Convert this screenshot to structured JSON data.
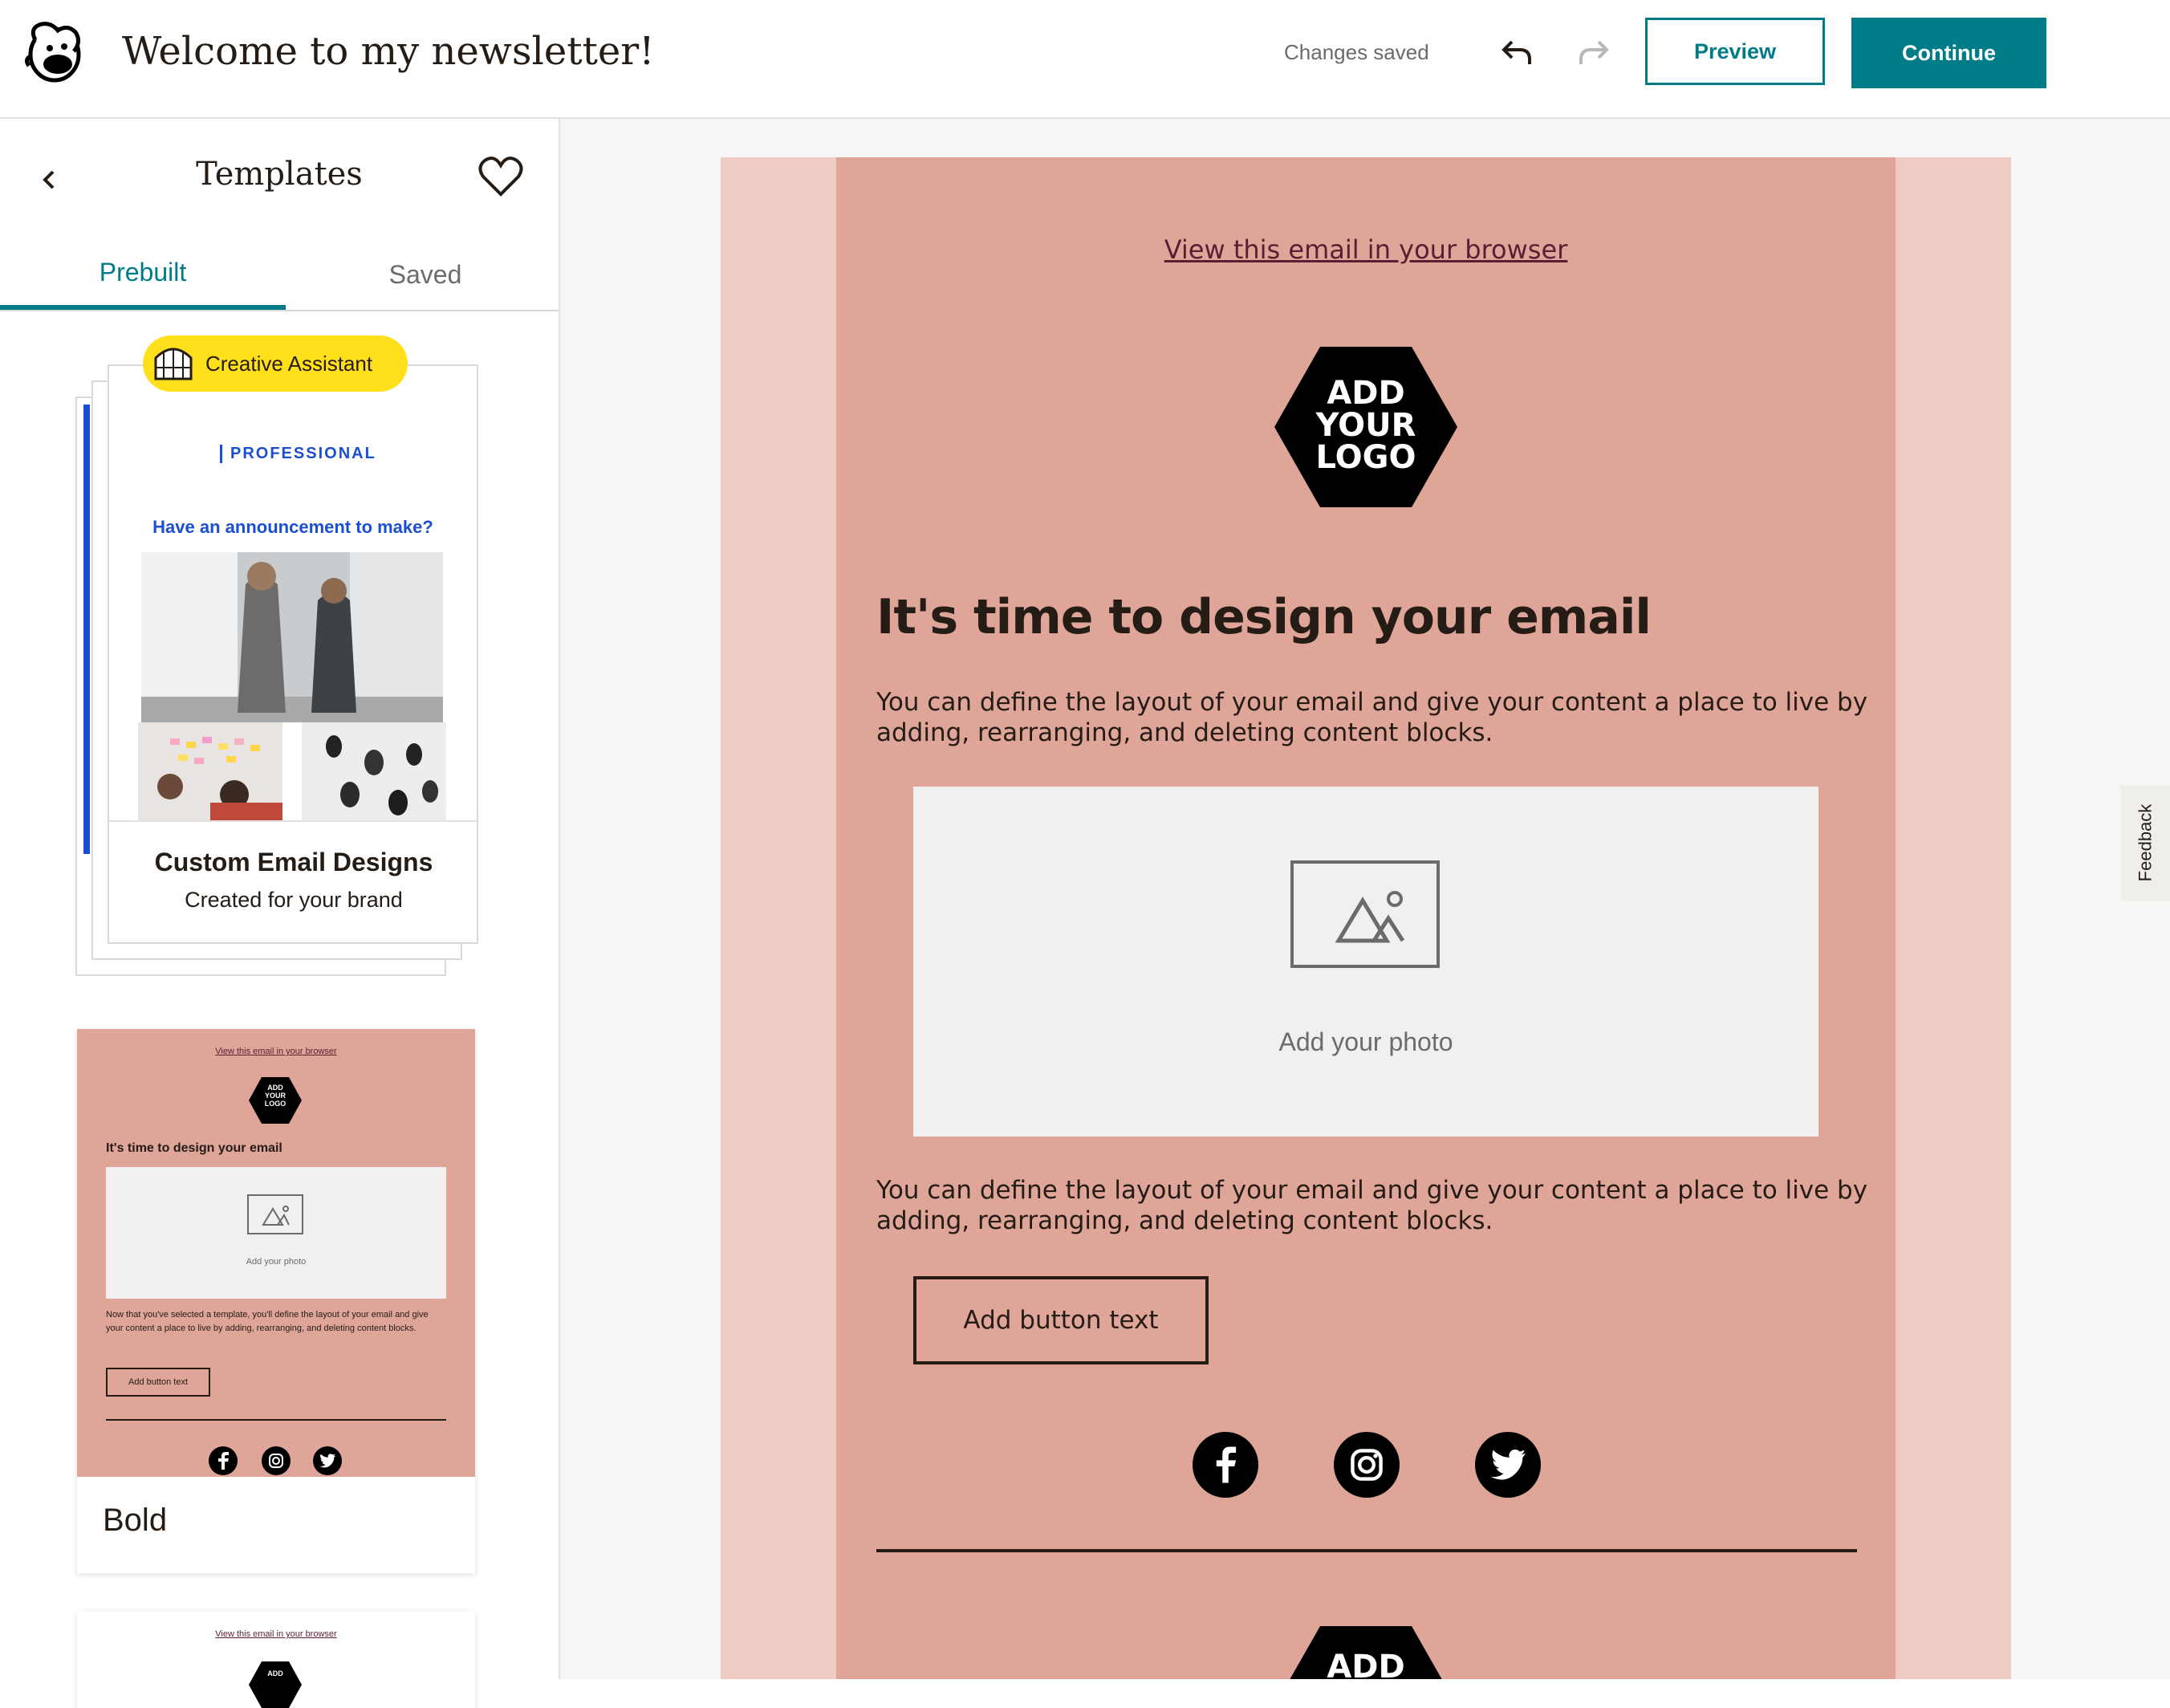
{
  "header": {
    "title": "Welcome to my newsletter!",
    "status": "Changes saved",
    "preview_label": "Preview",
    "continue_label": "Continue"
  },
  "sidebar": {
    "title": "Templates",
    "tabs": [
      {
        "label": "Prebuilt",
        "active": true
      },
      {
        "label": "Saved",
        "active": false
      }
    ],
    "custom_card": {
      "badge": "Creative Assistant",
      "brand_label": "PROFESSIONAL",
      "announcement": "Have an announcement to make?",
      "title": "Custom Email Designs",
      "subtitle": "Created for your brand"
    },
    "bold_card": {
      "name": "Bold",
      "thumb_link": "View this email in your browser",
      "thumb_logo": [
        "ADD",
        "YOUR",
        "LOGO"
      ],
      "thumb_headline": "It's time to design your email",
      "thumb_photo_label": "Add your photo",
      "thumb_body": "Now that you've selected a template, you'll define the layout of your email and give your content a place to live by adding, rearranging, and deleting content blocks.",
      "thumb_button": "Add button text"
    },
    "next_card": {
      "thumb_link": "View this email in your browser",
      "thumb_logo": "ADD"
    }
  },
  "email": {
    "view_link": "View this email in your browser",
    "logo_lines": [
      "ADD",
      "YOUR",
      "LOGO"
    ],
    "headline": "It's time to design your email",
    "body1": "You can define the layout of your email and give your content a place to live by adding, rearranging, and deleting content blocks.",
    "photo_label": "Add your photo",
    "body2": "You can define the layout of your email and give your content a place to live by adding, rearranging, and deleting content blocks.",
    "button_label": "Add button text",
    "social_icons": [
      "facebook-icon",
      "instagram-icon",
      "twitter-icon"
    ],
    "footer_logo": "ADD"
  },
  "feedback_label": "Feedback",
  "colors": {
    "accent": "#007c89",
    "email_bg": "#dfa599",
    "email_outer": "#efcac3",
    "badge": "#ffe01b",
    "pro_blue": "#1a4fd1"
  }
}
